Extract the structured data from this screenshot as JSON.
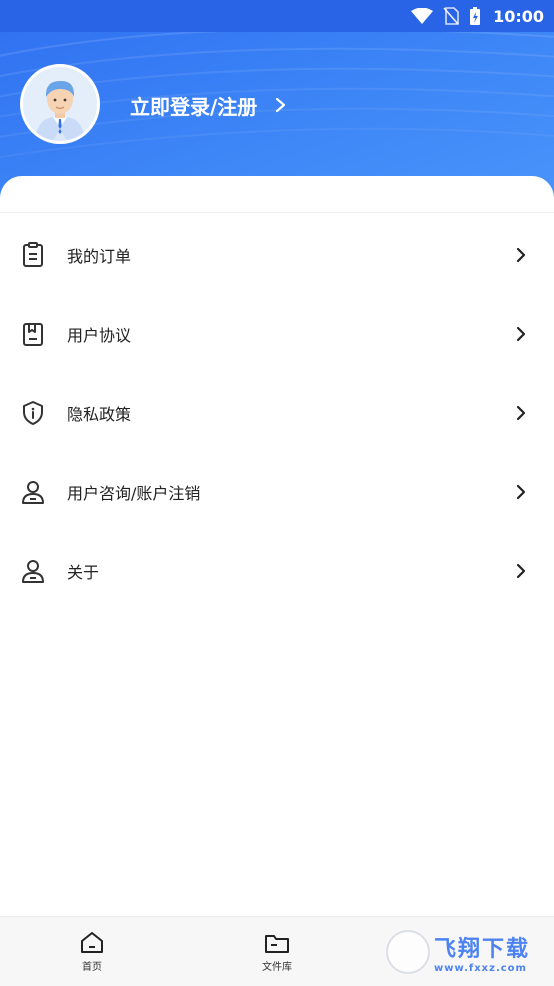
{
  "status_bar": {
    "time": "10:00"
  },
  "profile": {
    "login_text": "立即登录/注册"
  },
  "menu": [
    {
      "label": "我的订单",
      "icon": "clipboard-icon"
    },
    {
      "label": "用户协议",
      "icon": "bookmark-book-icon"
    },
    {
      "label": "隐私政策",
      "icon": "shield-info-icon"
    },
    {
      "label": "用户咨询/账户注销",
      "icon": "user-icon"
    },
    {
      "label": "关于",
      "icon": "user-icon"
    }
  ],
  "tabs": [
    {
      "label": "首页",
      "icon": "home-icon"
    },
    {
      "label": "文件库",
      "icon": "folder-icon"
    }
  ],
  "watermark": {
    "main": "飞翔下载",
    "sub": "www.fxxz.com"
  },
  "colors": {
    "brand_blue": "#2f6ff0",
    "text": "#222222"
  }
}
